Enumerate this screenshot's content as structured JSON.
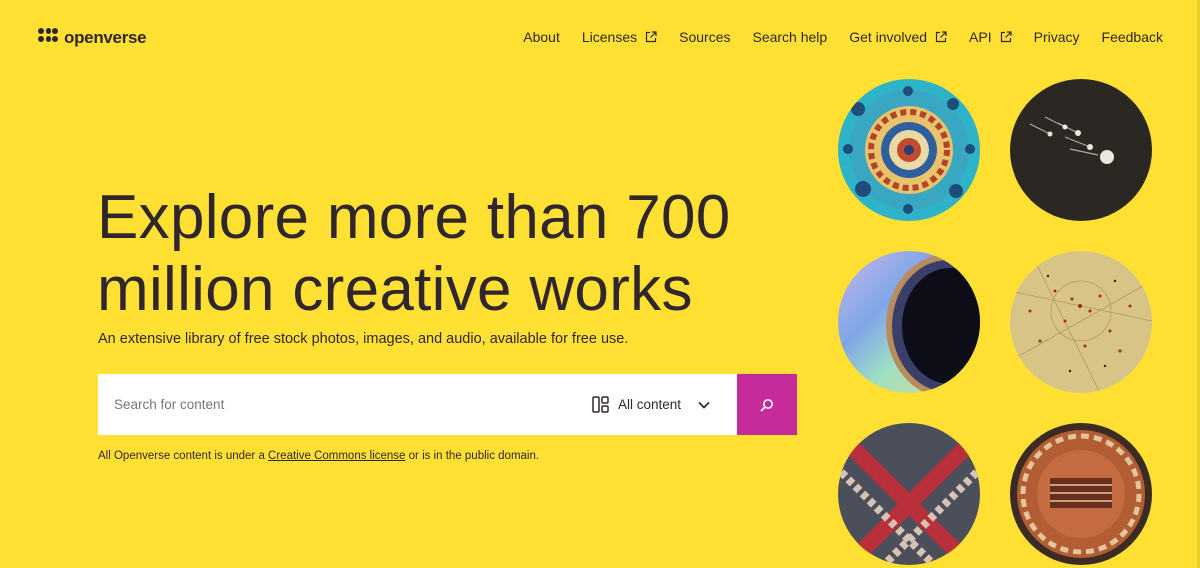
{
  "header": {
    "logo_text": "openverse",
    "nav": [
      {
        "label": "About",
        "external": false
      },
      {
        "label": "Licenses",
        "external": true
      },
      {
        "label": "Sources",
        "external": false
      },
      {
        "label": "Search help",
        "external": false
      },
      {
        "label": "Get involved",
        "external": true
      },
      {
        "label": "API",
        "external": true
      },
      {
        "label": "Privacy",
        "external": false
      },
      {
        "label": "Feedback",
        "external": false
      }
    ]
  },
  "hero": {
    "title_line1": "Explore more than 700",
    "title_line2": "million creative works",
    "subtitle": "An extensive library of free stock photos, images, and audio, available for free use."
  },
  "search": {
    "placeholder": "Search for content",
    "value": "",
    "content_type": "All content",
    "button_icon": "search-icon"
  },
  "footnote": {
    "prefix": "All Openverse content is under a ",
    "link": "Creative Commons license",
    "suffix": " or is in the public domain."
  },
  "gallery": [
    {
      "name": "mandala-tile-image"
    },
    {
      "name": "comets-illustration-image"
    },
    {
      "name": "planet-rings-image"
    },
    {
      "name": "star-map-image"
    },
    {
      "name": "textile-pattern-image"
    },
    {
      "name": "ornate-circle-image"
    }
  ],
  "colors": {
    "background": "#ffe033",
    "text": "#30272e",
    "accent": "#c52b9b"
  }
}
